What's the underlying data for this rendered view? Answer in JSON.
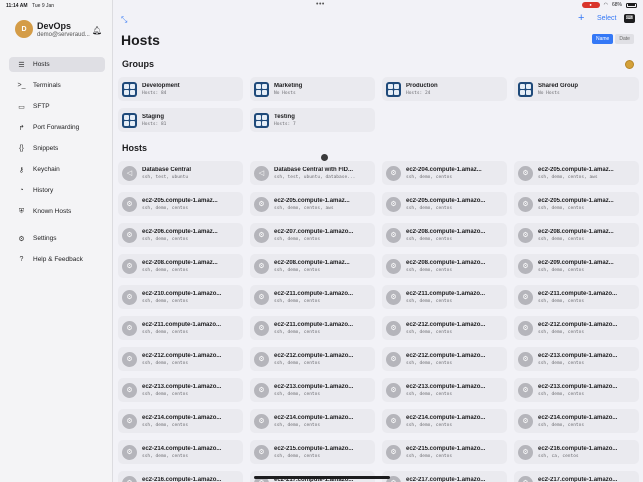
{
  "status": {
    "time": "11:14 AM",
    "date": "Tue 9 Jan",
    "battery": "68%"
  },
  "profile": {
    "initial": "D",
    "name": "DevOps",
    "email": "demo@serveraud..."
  },
  "nav": [
    {
      "label": "Hosts",
      "icon": "server-icon",
      "glyph": "☰"
    },
    {
      "label": "Terminals",
      "icon": "terminal-icon",
      "glyph": ">_"
    },
    {
      "label": "SFTP",
      "icon": "folder-icon",
      "glyph": "▭"
    },
    {
      "label": "Port Forwarding",
      "icon": "port-forward-icon",
      "glyph": "↱"
    },
    {
      "label": "Snippets",
      "icon": "braces-icon",
      "glyph": "{}"
    },
    {
      "label": "Keychain",
      "icon": "key-icon",
      "glyph": "⚷"
    },
    {
      "label": "History",
      "icon": "clock-icon",
      "glyph": "◔"
    },
    {
      "label": "Known Hosts",
      "icon": "shield-icon",
      "glyph": "⛨"
    },
    {
      "label": "Settings",
      "icon": "gear-icon",
      "glyph": "⚙"
    },
    {
      "label": "Help & Feedback",
      "icon": "help-icon",
      "glyph": "?"
    }
  ],
  "header": {
    "title": "Hosts",
    "select_label": "Select",
    "sort_name": "Name",
    "sort_date": "Date"
  },
  "groups_title": "Groups",
  "hosts_title": "Hosts",
  "groups": [
    {
      "name": "Development",
      "sub": "Hosts: 84"
    },
    {
      "name": "Marketing",
      "sub": "No Hosts"
    },
    {
      "name": "Production",
      "sub": "Hosts: 24"
    },
    {
      "name": "Shared Group",
      "sub": "No Hosts"
    },
    {
      "name": "Staging",
      "sub": "Hosts: 81"
    },
    {
      "name": "Testing",
      "sub": "Hosts: 7"
    }
  ],
  "hosts": [
    {
      "name": "Database Central",
      "sub": "ssh, test, ubuntu",
      "kind": "db"
    },
    {
      "name": "Database Central with FID...",
      "sub": "ssh, test, ubuntu, database...",
      "kind": "db"
    },
    {
      "name": "ec2-204.compute-1.amaz...",
      "sub": "ssh, demo, centos",
      "kind": "gear"
    },
    {
      "name": "ec2-205.compute-1.amaz...",
      "sub": "ssh, demo, centos, aws",
      "kind": "gear"
    },
    {
      "name": "ec2-205.compute-1.amaz...",
      "sub": "ssh, demo, centos",
      "kind": "gear"
    },
    {
      "name": "ec2-205.compute-1.amaz...",
      "sub": "ssh, demo, centos, aws",
      "kind": "gear"
    },
    {
      "name": "ec2-205.compute-1.amazo...",
      "sub": "ssh, demo, centos",
      "kind": "gear"
    },
    {
      "name": "ec2-205.compute-1.amaz...",
      "sub": "ssh, demo, centos",
      "kind": "gear"
    },
    {
      "name": "ec2-206.compute-1.amaz...",
      "sub": "ssh, demo, centos",
      "kind": "gear"
    },
    {
      "name": "ec2-207.compute-1.amazo...",
      "sub": "ssh, demo, centos",
      "kind": "gear"
    },
    {
      "name": "ec2-208.compute-1.amazo...",
      "sub": "ssh, demo, centos",
      "kind": "gear"
    },
    {
      "name": "ec2-208.compute-1.amaz...",
      "sub": "ssh, demo, centos",
      "kind": "gear"
    },
    {
      "name": "ec2-208.compute-1.amaz...",
      "sub": "ssh, demo, centos",
      "kind": "gear"
    },
    {
      "name": "ec2-208.compute-1.amaz...",
      "sub": "ssh, demo, centos",
      "kind": "gear"
    },
    {
      "name": "ec2-208.compute-1.amazo...",
      "sub": "ssh, demo, centos",
      "kind": "gear"
    },
    {
      "name": "ec2-209.compute-1.amaz...",
      "sub": "ssh, demo, centos",
      "kind": "gear"
    },
    {
      "name": "ec2-210.compute-1.amazo...",
      "sub": "ssh, demo, centos",
      "kind": "gear"
    },
    {
      "name": "ec2-211.compute-1.amazo...",
      "sub": "ssh, demo, centos",
      "kind": "gear"
    },
    {
      "name": "ec2-211.compute-1.amazo...",
      "sub": "ssh, demo, centos",
      "kind": "gear"
    },
    {
      "name": "ec2-211.compute-1.amazo...",
      "sub": "ssh, demo, centos",
      "kind": "gear"
    },
    {
      "name": "ec2-211.compute-1.amazo...",
      "sub": "ssh, demo, centos",
      "kind": "gear"
    },
    {
      "name": "ec2-211.compute-1.amazo...",
      "sub": "ssh, demo, centos",
      "kind": "gear"
    },
    {
      "name": "ec2-212.compute-1.amazo...",
      "sub": "ssh, demo, centos",
      "kind": "gear"
    },
    {
      "name": "ec2-212.compute-1.amazo...",
      "sub": "ssh, demo, centos",
      "kind": "gear"
    },
    {
      "name": "ec2-212.compute-1.amazo...",
      "sub": "ssh, demo, centos",
      "kind": "gear"
    },
    {
      "name": "ec2-212.compute-1.amazo...",
      "sub": "ssh, demo, centos",
      "kind": "gear"
    },
    {
      "name": "ec2-212.compute-1.amazo...",
      "sub": "ssh, demo, centos",
      "kind": "gear"
    },
    {
      "name": "ec2-213.compute-1.amazo...",
      "sub": "ssh, demo, centos",
      "kind": "gear"
    },
    {
      "name": "ec2-213.compute-1.amazo...",
      "sub": "ssh, demo, centos",
      "kind": "gear"
    },
    {
      "name": "ec2-213.compute-1.amazo...",
      "sub": "ssh, demo, centos",
      "kind": "gear"
    },
    {
      "name": "ec2-213.compute-1.amazo...",
      "sub": "ssh, demo, centos",
      "kind": "gear"
    },
    {
      "name": "ec2-213.compute-1.amazo...",
      "sub": "ssh, demo, centos",
      "kind": "gear"
    },
    {
      "name": "ec2-214.compute-1.amazo...",
      "sub": "ssh, demo, centos",
      "kind": "gear"
    },
    {
      "name": "ec2-214.compute-1.amazo...",
      "sub": "ssh, demo, centos",
      "kind": "gear"
    },
    {
      "name": "ec2-214.compute-1.amazo...",
      "sub": "ssh, demo, centos",
      "kind": "gear"
    },
    {
      "name": "ec2-214.compute-1.amazo...",
      "sub": "ssh, demo, centos",
      "kind": "gear"
    },
    {
      "name": "ec2-214.compute-1.amazo...",
      "sub": "ssh, demo, centos",
      "kind": "gear"
    },
    {
      "name": "ec2-215.compute-1.amazo...",
      "sub": "ssh, demo, centos",
      "kind": "gear"
    },
    {
      "name": "ec2-215.compute-1.amazo...",
      "sub": "ssh, demo, centos",
      "kind": "gear"
    },
    {
      "name": "ec2-216.compute-1.amazo...",
      "sub": "ssh, ca, centos",
      "kind": "gear"
    },
    {
      "name": "ec2-216.compute-1.amazo...",
      "sub": "ssh, demo, centos",
      "kind": "gear"
    },
    {
      "name": "ec2-217.compute-1.amazo...",
      "sub": "ssh, demo, centos",
      "kind": "gear"
    },
    {
      "name": "ec2-217.compute-1.amazo...",
      "sub": "ssh, demo, centos",
      "kind": "gear"
    },
    {
      "name": "ec2-217.compute-1.amazo...",
      "sub": "ssh, demo, centos",
      "kind": "gear"
    }
  ]
}
